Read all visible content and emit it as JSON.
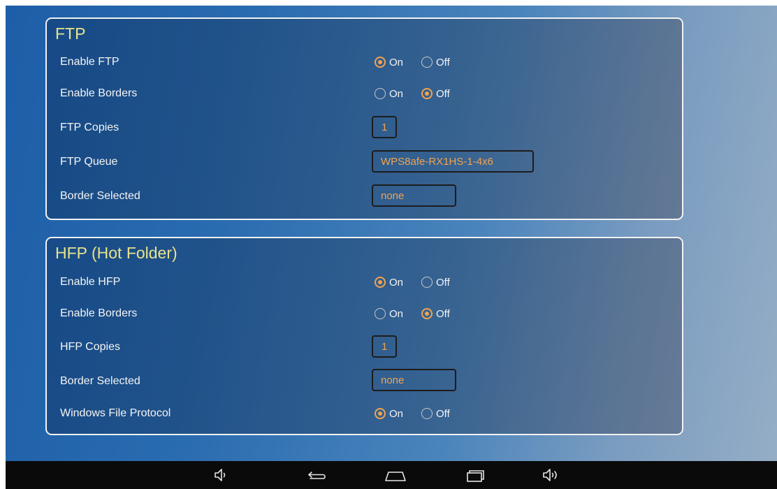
{
  "ftp": {
    "title": "FTP",
    "enable_ftp": {
      "label": "Enable FTP",
      "on_label": "On",
      "off_label": "Off",
      "selected": "On"
    },
    "enable_borders": {
      "label": "Enable Borders",
      "on_label": "On",
      "off_label": "Off",
      "selected": "Off"
    },
    "copies": {
      "label": "FTP Copies",
      "value": "1"
    },
    "queue": {
      "label": "FTP Queue",
      "value": "WPS8afe-RX1HS-1-4x6"
    },
    "border_selected": {
      "label": "Border Selected",
      "value": "none"
    }
  },
  "hfp": {
    "title": "HFP (Hot Folder)",
    "enable_hfp": {
      "label": "Enable HFP",
      "on_label": "On",
      "off_label": "Off",
      "selected": "On"
    },
    "enable_borders": {
      "label": "Enable Borders",
      "on_label": "On",
      "off_label": "Off",
      "selected": "Off"
    },
    "copies": {
      "label": "HFP Copies",
      "value": "1"
    },
    "border_selected": {
      "label": "Border Selected",
      "value": "none"
    },
    "windows_file_protocol": {
      "label": "Windows File Protocol",
      "on_label": "On",
      "off_label": "Off",
      "selected": "On"
    }
  },
  "navbar": {
    "icons": [
      "volume-down-icon",
      "back-icon",
      "home-icon",
      "recent-apps-icon",
      "volume-up-icon"
    ]
  },
  "colors": {
    "accent": "#f2a34f",
    "title": "#e8e38a",
    "text": "#f4f4f4",
    "navbar": "#0a0a0a"
  }
}
